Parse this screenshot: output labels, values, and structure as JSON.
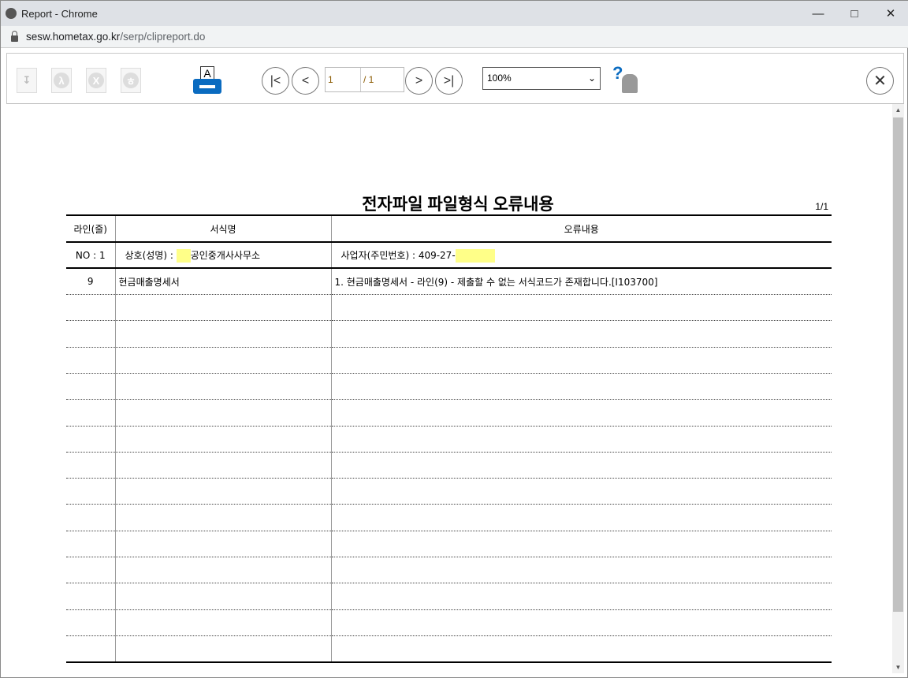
{
  "window": {
    "title": "Report - Chrome",
    "url_host": "sesw.hometax.go.kr",
    "url_path": "/serp/clipreport.do"
  },
  "toolbar": {
    "page_current": "1",
    "page_total": "/ 1",
    "zoom": "100%",
    "print_letter": "A",
    "help_glyph": "?"
  },
  "report": {
    "title": "전자파일 파일형식 오류내용",
    "page": "1/1",
    "headers": [
      "라인(줄)",
      "서식명",
      "오류내용"
    ],
    "no_row": {
      "no": "NO : 1",
      "name_label": "상호(성명) :",
      "name_suffix": "공인중개사사무소",
      "biz_label": "사업자(주민번호) : 409-27-"
    },
    "rows": [
      {
        "line": "9",
        "form": "현금매출명세서",
        "error": "1. 현금매출명세서  - 라인(9) - 제출할 수 없는 서식코드가 존재합니다.[I103700]"
      }
    ]
  }
}
